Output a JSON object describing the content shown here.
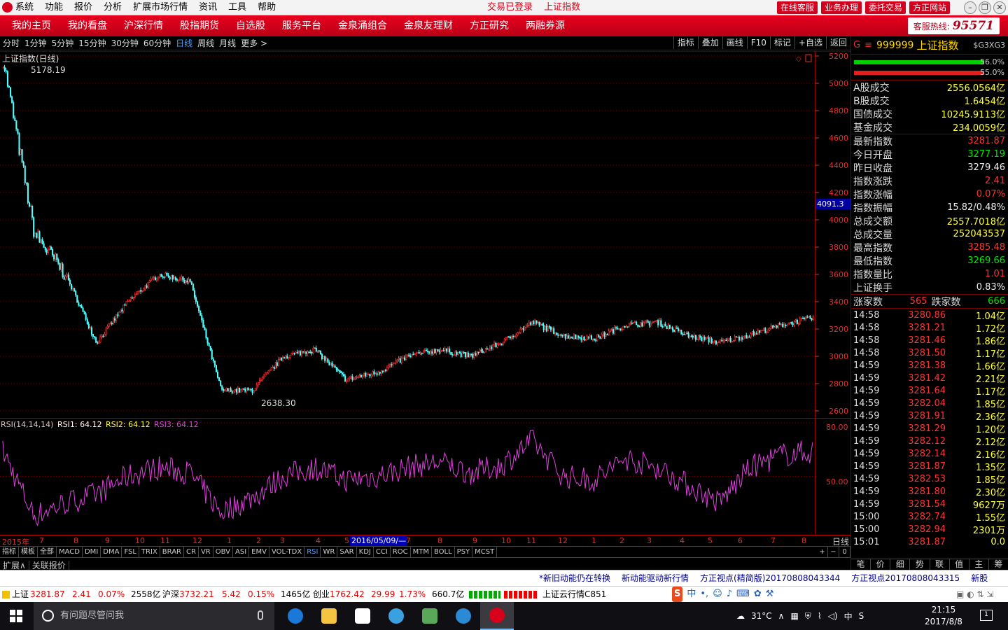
{
  "titlebar": {
    "menu": [
      "系统",
      "功能",
      "报价",
      "分析",
      "扩展市场行情",
      "资讯",
      "工具",
      "帮助"
    ],
    "status": [
      "交易已登录",
      "上证指数"
    ],
    "buttons": [
      "在线客服",
      "业务办理",
      "委托交易",
      "方正网站"
    ]
  },
  "nav": {
    "items": [
      "我的主页",
      "我的看盘",
      "沪深行情",
      "股指期货",
      "自选股",
      "服务平台",
      "金泉涌组合",
      "金泉友理财",
      "方正研究",
      "两融券源"
    ],
    "hotline_label": "客服热线:",
    "hotline_number": "95571"
  },
  "periods": {
    "items": [
      "分时",
      "1分钟",
      "5分钟",
      "15分钟",
      "30分钟",
      "60分钟",
      "日线",
      "周线",
      "月线",
      "更多 >"
    ],
    "selected": "日线",
    "tools": [
      "指标",
      "叠加",
      "画线",
      "F10",
      "标记",
      "+自选",
      "返回"
    ]
  },
  "chart": {
    "title": "上证指数(日线)",
    "high_label": "5178.19",
    "low_label": "2638.30",
    "cursor_value": "4091.3",
    "rsi_label_prefix": "RSI(14,14,14)",
    "rsi1": "RSI1: 64.12",
    "rsi2": "RSI2: 64.12",
    "rsi3": "RSI3: 64.12",
    "rsi_80": "80.00",
    "rsi_50": "50.00",
    "y_ticks": [
      "5200",
      "5000",
      "4800",
      "4600",
      "4400",
      "4200",
      "4000",
      "3800",
      "3600",
      "3400",
      "3200",
      "3000",
      "2800",
      "2600"
    ],
    "x_labels": [
      "2015年",
      "7",
      "8",
      "9",
      "10",
      "11",
      "12",
      "1",
      "2",
      "3",
      "4",
      "5",
      "7",
      "8",
      "9",
      "10",
      "11",
      "12",
      "1",
      "2",
      "3",
      "4",
      "5",
      "6",
      "7",
      "8"
    ],
    "current_date": "2016/05/09/—",
    "day_label": "日线"
  },
  "chart_data": {
    "type": "line",
    "title": "上证指数(日线)",
    "series": [
      {
        "name": "上证指数",
        "x": [
          "2015-06",
          "2015-07",
          "2015-08",
          "2015-09",
          "2015-10",
          "2015-11",
          "2015-12",
          "2016-01",
          "2016-02",
          "2016-03",
          "2016-04",
          "2016-05",
          "2016-06",
          "2016-07",
          "2016-08",
          "2016-09",
          "2016-10",
          "2016-11",
          "2016-12",
          "2017-01",
          "2017-02",
          "2017-03",
          "2017-04",
          "2017-05",
          "2017-06",
          "2017-07",
          "2017-08"
        ],
        "values": [
          5178,
          3900,
          3600,
          3100,
          3400,
          3600,
          3550,
          2750,
          2750,
          3000,
          3050,
          2830,
          2880,
          3000,
          3050,
          3000,
          3100,
          3250,
          3150,
          3130,
          3230,
          3250,
          3150,
          3100,
          3160,
          3230,
          3282
        ]
      },
      {
        "name": "RSI1",
        "values": [
          64,
          28,
          35,
          40,
          50,
          55,
          52,
          30,
          38,
          50,
          55,
          48,
          50,
          55,
          58,
          52,
          56,
          70,
          50,
          48,
          60,
          55,
          45,
          35,
          55,
          62,
          64
        ]
      }
    ],
    "ylim": [
      2600,
      5200
    ],
    "rsi_ylim": [
      20,
      80
    ],
    "grid": true
  },
  "quote": {
    "g": "G",
    "code": "999999",
    "name": "上证指数",
    "sub": "$G3XG3",
    "bar1": {
      "green": 0.88,
      "pct": "56.0%"
    },
    "bar2": {
      "red": 0.88,
      "pct": "55.0%"
    },
    "volumes": [
      {
        "k": "A股成交",
        "v": "2556.0564亿"
      },
      {
        "k": "B股成交",
        "v": "1.6454亿"
      },
      {
        "k": "国债成交",
        "v": "10245.9113亿"
      },
      {
        "k": "基金成交",
        "v": "234.0059亿"
      }
    ],
    "stats": [
      {
        "k": "最新指数",
        "v": "3281.87",
        "c": "red"
      },
      {
        "k": "今日开盘",
        "v": "3277.19",
        "c": "green"
      },
      {
        "k": "昨日收盘",
        "v": "3279.46",
        "c": "white"
      },
      {
        "k": "指数涨跌",
        "v": "2.41",
        "c": "red"
      },
      {
        "k": "指数涨幅",
        "v": "0.07%",
        "c": "red"
      },
      {
        "k": "指数振幅",
        "v": "15.82/0.48%",
        "c": "white"
      },
      {
        "k": "总成交额",
        "v": "2557.7018亿",
        "c": "yellow"
      },
      {
        "k": "总成交量",
        "v": "252043537",
        "c": "yellow"
      },
      {
        "k": "最高指数",
        "v": "3285.48",
        "c": "red"
      },
      {
        "k": "最低指数",
        "v": "3269.66",
        "c": "green"
      },
      {
        "k": "指数量比",
        "v": "1.01",
        "c": "red"
      },
      {
        "k": "上证换手",
        "v": "0.83%",
        "c": "white"
      }
    ],
    "up_label": "涨家数",
    "up_value": "565",
    "down_label": "跌家数",
    "down_value": "666",
    "ticks": [
      {
        "t": "14:58",
        "p": "3280.86",
        "v": "1.04亿"
      },
      {
        "t": "14:58",
        "p": "3281.21",
        "v": "1.72亿"
      },
      {
        "t": "14:58",
        "p": "3281.46",
        "v": "1.86亿"
      },
      {
        "t": "14:58",
        "p": "3281.50",
        "v": "1.17亿"
      },
      {
        "t": "14:59",
        "p": "3281.38",
        "v": "1.66亿"
      },
      {
        "t": "14:59",
        "p": "3281.42",
        "v": "2.21亿"
      },
      {
        "t": "14:59",
        "p": "3281.64",
        "v": "1.17亿"
      },
      {
        "t": "14:59",
        "p": "3282.04",
        "v": "1.85亿"
      },
      {
        "t": "14:59",
        "p": "3281.91",
        "v": "2.36亿"
      },
      {
        "t": "14:59",
        "p": "3281.29",
        "v": "1.20亿"
      },
      {
        "t": "14:59",
        "p": "3282.12",
        "v": "2.12亿"
      },
      {
        "t": "14:59",
        "p": "3282.14",
        "v": "2.16亿"
      },
      {
        "t": "14:59",
        "p": "3281.87",
        "v": "1.35亿"
      },
      {
        "t": "14:59",
        "p": "3282.53",
        "v": "1.85亿"
      },
      {
        "t": "14:59",
        "p": "3281.80",
        "v": "2.30亿"
      },
      {
        "t": "14:59",
        "p": "3281.54",
        "v": "9627万"
      },
      {
        "t": "15:00",
        "p": "3282.74",
        "v": "1.55亿"
      },
      {
        "t": "15:00",
        "p": "3282.94",
        "v": "2301万"
      },
      {
        "t": "15:01",
        "p": "3281.87",
        "v": "0.0"
      }
    ],
    "tabs": [
      "笔",
      "价",
      "细",
      "势",
      "联",
      "值",
      "主",
      "筹"
    ]
  },
  "indicator_tabs": [
    "指标",
    "模板",
    "全部",
    "MACD",
    "DMI",
    "DMA",
    "FSL",
    "TRIX",
    "BRAR",
    "CR",
    "VR",
    "OBV",
    "ASI",
    "EMV",
    "VOL-TDX",
    "RSI",
    "WR",
    "SAR",
    "KDJ",
    "CCI",
    "ROC",
    "MTM",
    "BOLL",
    "PSY",
    "MCST"
  ],
  "indicator_selected": "RSI",
  "ext_tabs": [
    "扩展∧",
    "关联报价"
  ],
  "news_ticker": [
    "*新旧动能仍在转换",
    "新动能驱动新行情",
    "方正视点(精简版)20170808043344",
    "方正视点20170808043315",
    "新股"
  ],
  "statusbar": {
    "sh_label": "上证",
    "sh_value": "3281.87",
    "sh_change": "2.41",
    "sh_pct": "0.07%",
    "sh_amount": "2558亿",
    "hs_label": "沪深",
    "hs_value": "3732.21",
    "hs_change": "5.42",
    "hs_pct": "0.15%",
    "hs_amount": "1465亿",
    "cy_label": "创业",
    "cy_value": "1762.42",
    "cy_change": "29.99",
    "cy_pct": "1.73%",
    "cy_amount": "660.7亿",
    "cloud": "上证云行情C851"
  },
  "taskbar": {
    "search_placeholder": "有问题尽管问我",
    "weather": "31°C",
    "ime": "中",
    "time": "21:15",
    "date": "2017/8/8",
    "notif": "1"
  }
}
